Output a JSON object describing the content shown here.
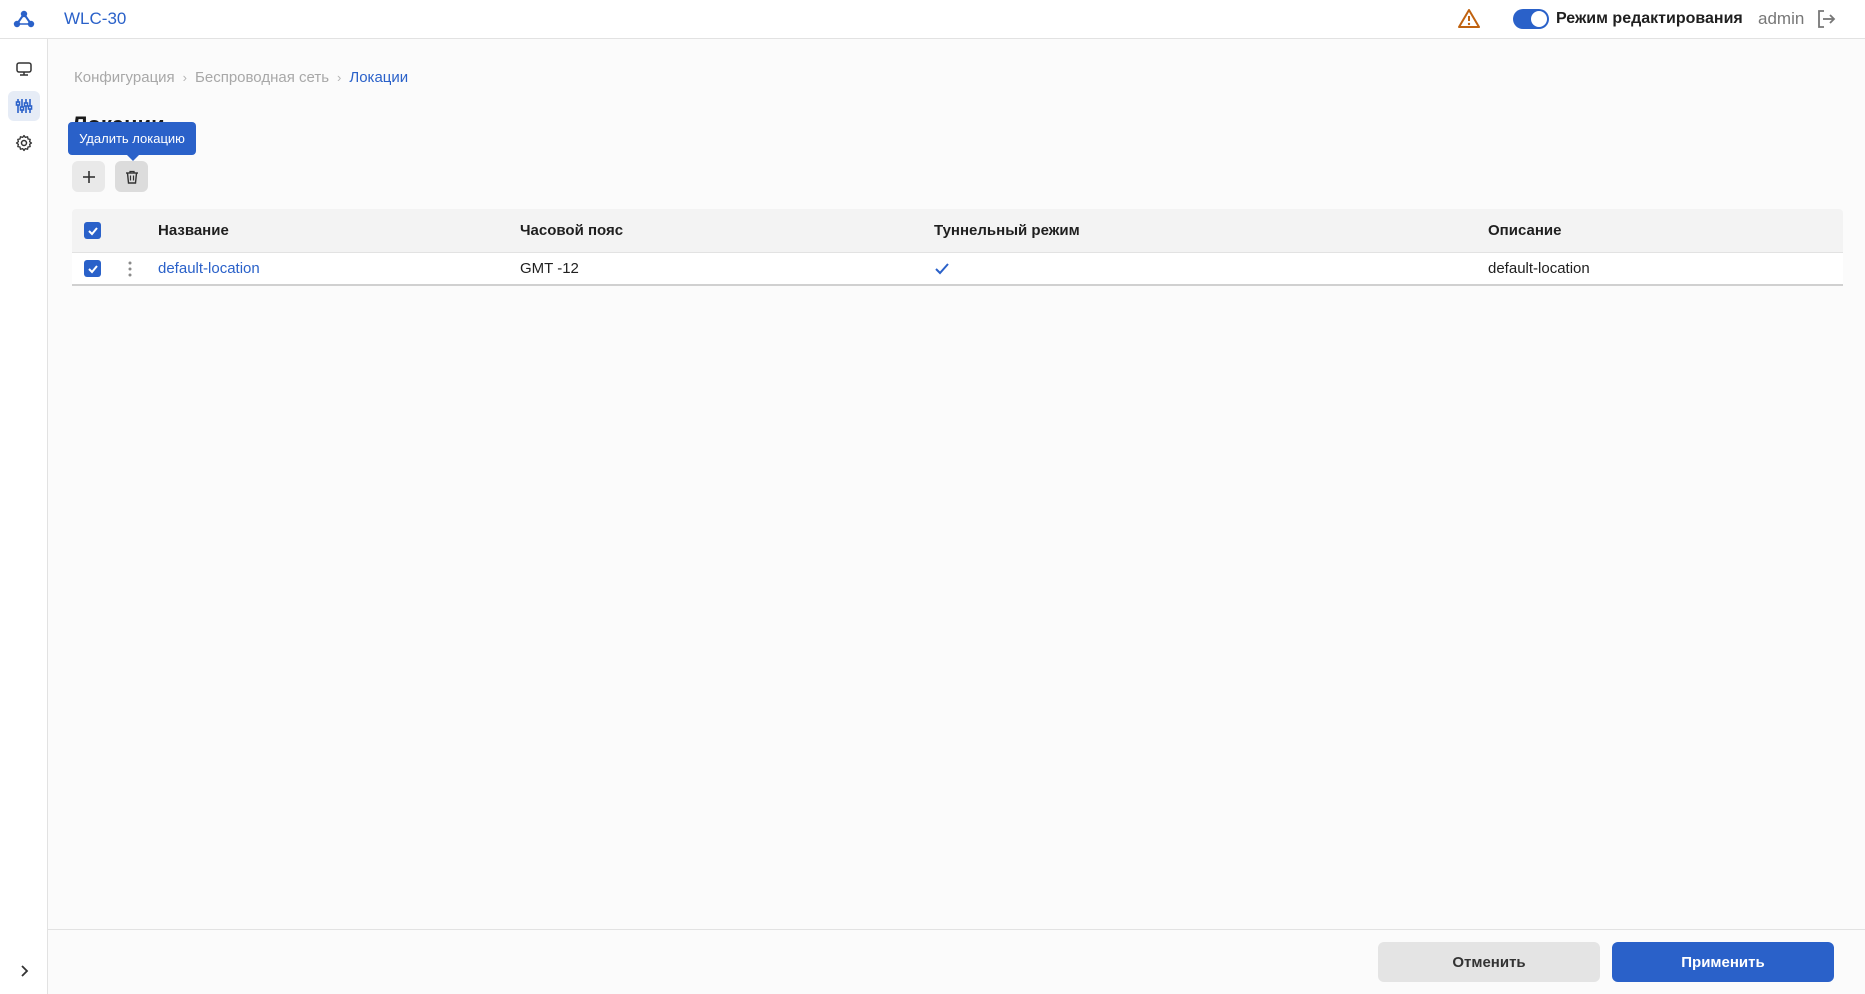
{
  "app": {
    "title": "WLC-30"
  },
  "header": {
    "edit_mode_label": "Режим редактирования",
    "edit_mode_on": true,
    "user": "admin"
  },
  "breadcrumb": [
    "Конфигурация",
    "Беспроводная сеть",
    "Локации"
  ],
  "page": {
    "title": "Локации"
  },
  "toolbar": {
    "delete_tooltip": "Удалить локацию"
  },
  "table": {
    "columns": [
      "Название",
      "Часовой пояс",
      "Туннельный режим",
      "Описание"
    ],
    "header_checked": true,
    "rows": [
      {
        "checked": true,
        "name": "default-location",
        "timezone": "GMT -12",
        "tunnel": true,
        "description": "default-location"
      }
    ]
  },
  "footer": {
    "cancel_label": "Отменить",
    "apply_label": "Применить"
  },
  "colors": {
    "accent": "#2a61c9",
    "warning": "#c0620f"
  }
}
